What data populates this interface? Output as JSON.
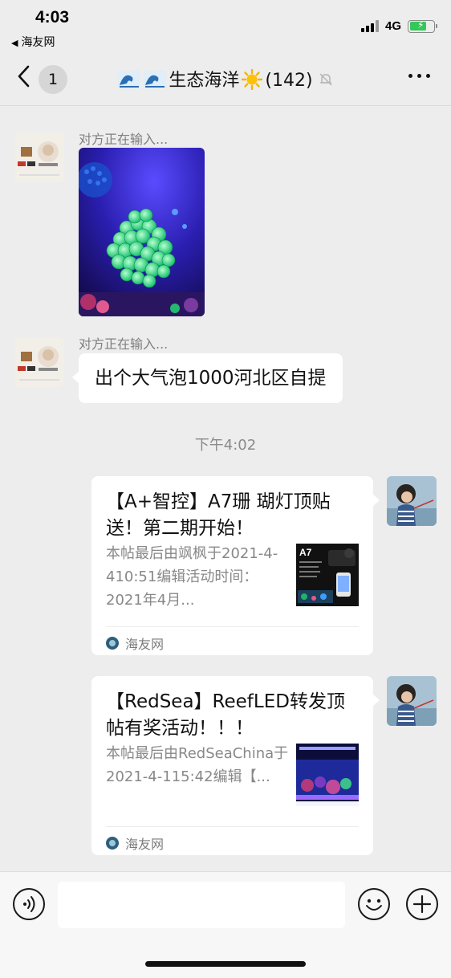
{
  "status_bar": {
    "time": "4:03",
    "back_app": "海友网",
    "network": "4G"
  },
  "nav": {
    "back_badge": "1",
    "title": "生态海洋",
    "member_count": "(142)"
  },
  "messages": {
    "msg1": {
      "sender": "对方正在输入..."
    },
    "msg2": {
      "sender": "对方正在输入...",
      "text": "出个大气泡1000河北区自提"
    },
    "timestamp": "下午4:02",
    "card1": {
      "title": "【A+智控】A7珊 瑚灯顶贴送！第二期开始！",
      "description": "本帖最后由飒枫于2021-4-410:51编辑活动时间：2021年4月...",
      "source": "海友网",
      "thumb_label": "A7"
    },
    "card2": {
      "title": "【RedSea】ReefLED转发顶帖有奖活动！！！",
      "description": "本帖最后由RedSeaChina于2021-4-115:42编辑【...",
      "source": "海友网"
    }
  },
  "colors": {
    "background": "#ededed",
    "bubble": "#ffffff",
    "battery": "#34c759"
  },
  "icons": [
    "back-chevron-icon",
    "wave-emoji-icon",
    "sun-emoji-icon",
    "mute-bell-icon",
    "more-icon",
    "voice-icon",
    "emoji-icon",
    "plus-icon"
  ]
}
